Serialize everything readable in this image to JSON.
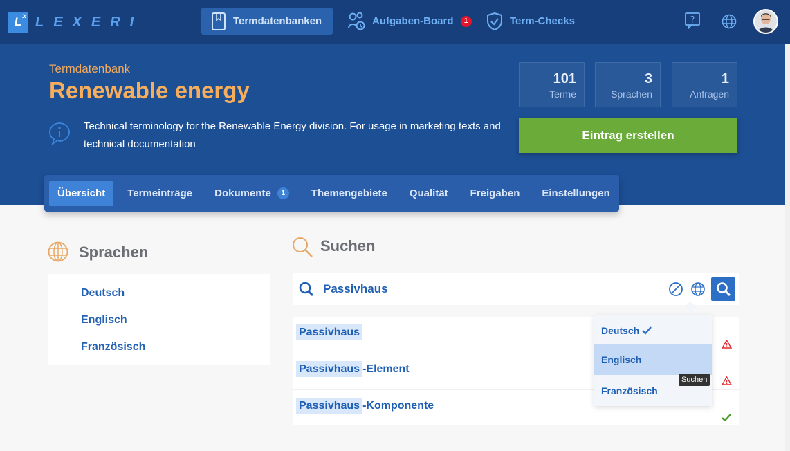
{
  "app": {
    "logo_mark": "L",
    "logo_sup": "x",
    "logo_text": "LEXERI"
  },
  "topnav": {
    "items": [
      {
        "label": "Termdatenbanken",
        "icon": "book-icon",
        "active": true
      },
      {
        "label": "Aufgaben-Board",
        "icon": "tasks-icon",
        "badge": "1"
      },
      {
        "label": "Term-Checks",
        "icon": "shield-check-icon"
      }
    ],
    "right_icons": [
      "help-icon",
      "globe-icon",
      "avatar"
    ]
  },
  "header": {
    "subtitle": "Termdatenbank",
    "title": "Renewable energy",
    "description": "Technical terminology for the Renewable Energy division. For usage in marketing texts and technical documentation",
    "stats": [
      {
        "value": "101",
        "label": "Terme"
      },
      {
        "value": "3",
        "label": "Sprachen"
      },
      {
        "value": "1",
        "label": "Anfragen"
      }
    ],
    "cta_label": "Eintrag erstellen"
  },
  "tabs": [
    {
      "label": "Übersicht",
      "active": true
    },
    {
      "label": "Termeinträge"
    },
    {
      "label": "Dokumente",
      "badge": "1"
    },
    {
      "label": "Themengebiete"
    },
    {
      "label": "Qualität"
    },
    {
      "label": "Freigaben"
    },
    {
      "label": "Einstellungen"
    }
  ],
  "languages": {
    "title": "Sprachen",
    "items": [
      "Deutsch",
      "Englisch",
      "Französisch"
    ]
  },
  "search": {
    "title": "Suchen",
    "query": "Passivhaus",
    "results": [
      {
        "match": "Passivhaus",
        "rest": "",
        "status": "warning"
      },
      {
        "match": "Passivhaus",
        "rest": "-Element",
        "status": "warning"
      },
      {
        "match": "Passivhaus",
        "rest": "-Komponente",
        "status": "ok"
      }
    ],
    "language_dropdown": {
      "items": [
        "Deutsch",
        "Englisch",
        "Französisch"
      ],
      "checked": "Deutsch",
      "hovered": "Englisch"
    },
    "tooltip": "Suchen"
  },
  "colors": {
    "topbar": "#173f7c",
    "header": "#1d4f95",
    "accent_orange": "#f7ae5c",
    "cta_green": "#6aab39",
    "warning": "#e0282d",
    "ok": "#4c9a2a"
  }
}
